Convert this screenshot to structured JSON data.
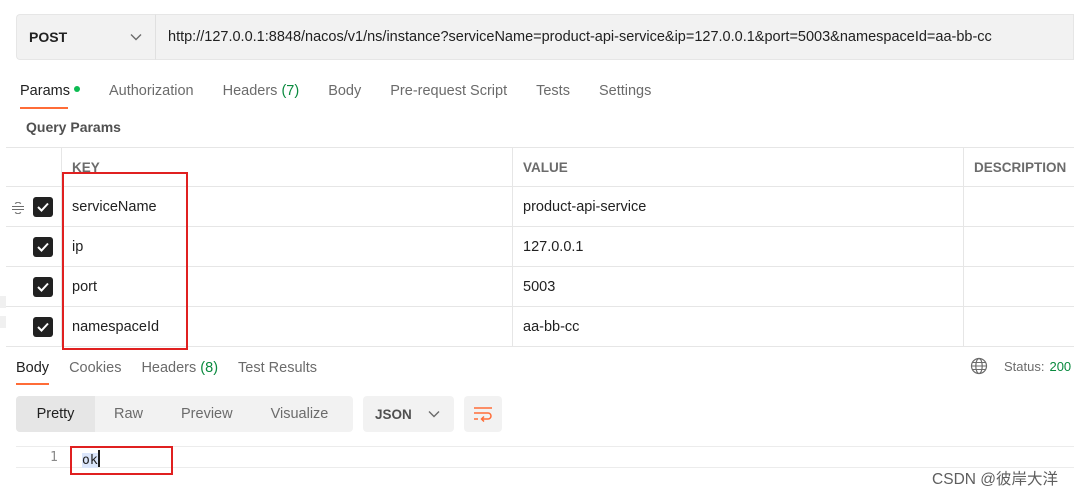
{
  "request": {
    "method": "POST",
    "url": "http://127.0.0.1:8848/nacos/v1/ns/instance?serviceName=product-api-service&ip=127.0.0.1&port=5003&namespaceId=aa-bb-cc"
  },
  "request_tabs": {
    "params": "Params",
    "authorization": "Authorization",
    "headers": "Headers",
    "headers_count": "(7)",
    "body": "Body",
    "prerequest": "Pre-request Script",
    "tests": "Tests",
    "settings": "Settings"
  },
  "query_params": {
    "section_title": "Query Params",
    "columns": {
      "key": "KEY",
      "value": "VALUE",
      "description": "DESCRIPTION"
    },
    "rows": [
      {
        "key": "serviceName",
        "value": "product-api-service",
        "checked": true
      },
      {
        "key": "ip",
        "value": "127.0.0.1",
        "checked": true
      },
      {
        "key": "port",
        "value": "5003",
        "checked": true
      },
      {
        "key": "namespaceId",
        "value": "aa-bb-cc",
        "checked": true
      }
    ]
  },
  "response_tabs": {
    "body": "Body",
    "cookies": "Cookies",
    "headers": "Headers",
    "headers_count": "(8)",
    "test_results": "Test Results"
  },
  "status": {
    "label": "Status:",
    "value": "200"
  },
  "format": {
    "pretty": "Pretty",
    "raw": "Raw",
    "preview": "Preview",
    "visualize": "Visualize",
    "language": "JSON"
  },
  "response_body": {
    "line_number": "1",
    "content": "ok"
  },
  "watermark": "CSDN @彼岸大洋",
  "colors": {
    "accent": "#ff6c37",
    "success": "#0cbb52",
    "annotation": "#e02020"
  },
  "icons": [
    "chevron-down-icon",
    "drag-handle-icon",
    "checkbox-checked-icon",
    "globe-icon",
    "wrap-lines-icon"
  ]
}
